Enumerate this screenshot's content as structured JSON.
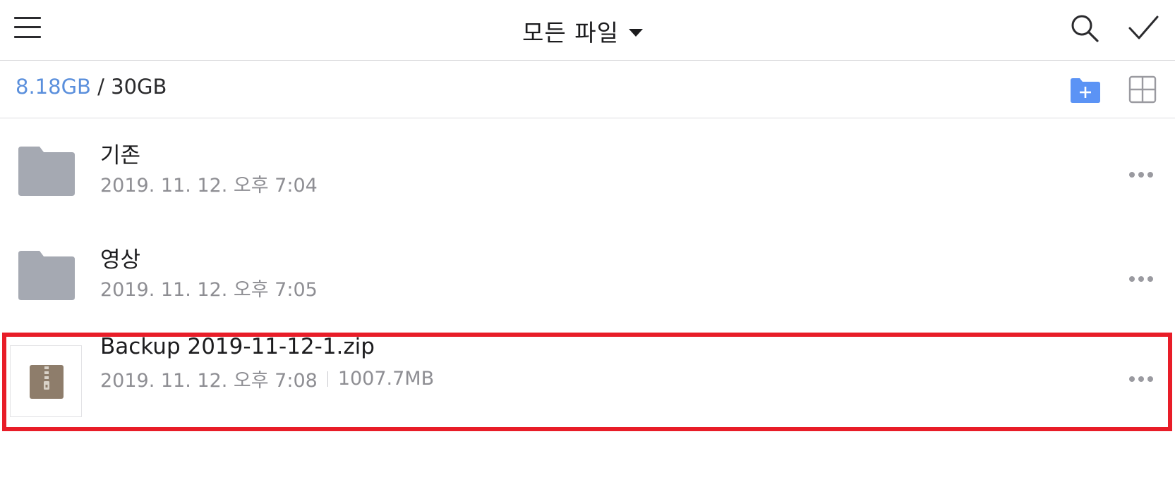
{
  "header": {
    "title": "모든 파일",
    "icons": {
      "menu": "menu-icon",
      "search": "search-icon",
      "select": "check-icon",
      "dropdown": "caret-down-icon"
    }
  },
  "storage": {
    "used": "8.18GB",
    "separator": " / ",
    "total": "30GB",
    "icons": {
      "new_folder": "new-folder-icon",
      "view_mode": "grid-view-icon"
    },
    "colors": {
      "used": "#5a8fdc",
      "new_folder": "#5b93f5"
    }
  },
  "files": [
    {
      "name": "기존",
      "date": "2019. 11. 12. 오후 7:04",
      "type": "folder"
    },
    {
      "name": "영상",
      "date": "2019. 11. 12. 오후 7:05",
      "type": "folder"
    },
    {
      "name": "Backup 2019-11-12-1.zip",
      "date": "2019. 11. 12. 오후 7:08",
      "size": "1007.7MB",
      "type": "zip"
    }
  ],
  "highlight": {
    "target": "Backup 2019-11-12-1.zip",
    "color": "#e81d28"
  }
}
